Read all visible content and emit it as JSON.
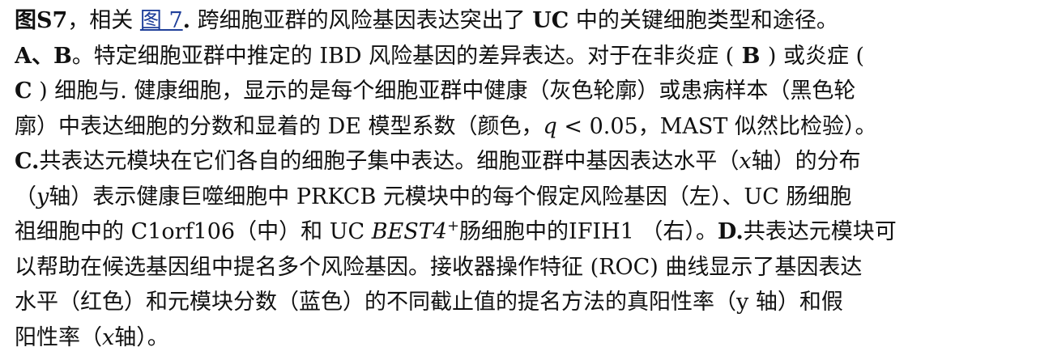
{
  "caption": {
    "line1": {
      "label": "图S7",
      "sep": "，相关 ",
      "link": "图 7",
      "dot": ".",
      "text1": " 跨细胞亚群的风险基因表达突出了 ",
      "uc": "UC",
      "text2": " 中的关键细胞类型和途径。"
    },
    "line2": {
      "ab": "A、B",
      "text1": "。特定细胞亚群中推定的 IBD 风险基因的差异表达。对于在非炎症 (",
      "b": " B ",
      "text2": ") 或炎症 ("
    },
    "line3": {
      "c": "C",
      "text": " ) 细胞与. 健康细胞，显示的是每个细胞亚群中健康（灰色轮廓）或患病样本（黑色轮"
    },
    "line4": {
      "text1": "廓）中表达细胞的分数和显着的 DE 模型系数（颜色，",
      "q": "q",
      "text2": " < 0.05，MAST 似然比检验）。"
    },
    "line5": {
      "c": "C.",
      "text1": "共表达元模块在它们各自的细胞子集中表达。细胞亚群中基因表达水平（",
      "x": "x",
      "text2": "轴）的分布"
    },
    "line6": {
      "text1": "（",
      "y": "y",
      "text2": "轴）表示健康巨噬细胞中 PRKCB 元模块中的每个假定风险基因（左）、UC 肠细胞"
    },
    "line7": {
      "text1": "祖细胞中的 C1orf106（中）和 UC ",
      "best4": "BEST4",
      "sup": "+",
      "text2": "肠细胞中的IFIH1 （右）。",
      "d": "D.",
      "text3": "共表达元模块可"
    },
    "line8": {
      "text": "以帮助在候选基因组中提名多个风险基因。接收器操作特征 (ROC) 曲线显示了基因表达"
    },
    "line9": {
      "text": "水平（红色）和元模块分数（蓝色）的不同截止值的提名方法的真阳性率（y 轴）和假"
    },
    "line10": {
      "text1": "阳性率（",
      "x": "x",
      "text2": "轴）。"
    }
  },
  "colors": {
    "text": "#111111",
    "link": "#1f3f9a",
    "background": "#ffffff"
  }
}
